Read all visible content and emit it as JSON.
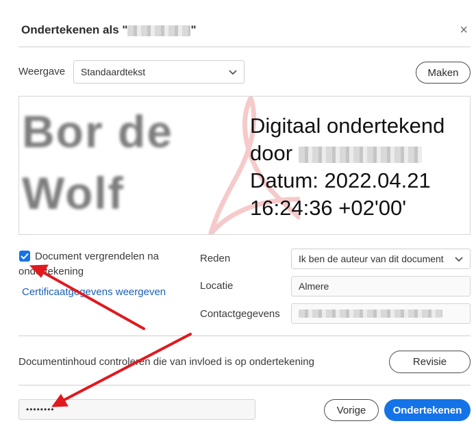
{
  "dialog": {
    "title_prefix": "Ondertekenen als \"",
    "title_suffix": "\"",
    "close_glyph": "×"
  },
  "appearance": {
    "label": "Weergave",
    "selected": "Standaardtekst",
    "make_button": "Maken"
  },
  "preview": {
    "name_lines": [
      "Bor de",
      "Wolf"
    ],
    "line1": "Digitaal ondertekend",
    "line2_prefix": "door",
    "line3": "Datum: 2022.04.21",
    "line4": "16:24:36 +02'00'"
  },
  "lock_document": {
    "checked": true,
    "label_line1": "Document vergrendelen na",
    "label_line2": "ondertekening"
  },
  "certificate_link": "Certificaatgegevens weergeven",
  "details": {
    "reason_label": "Reden",
    "reason_value": "Ik ben de auteur van dit document",
    "location_label": "Locatie",
    "location_value": "Almere",
    "contact_label": "Contactgegevens"
  },
  "review": {
    "text": "Documentinhoud controleren die van invloed is op ondertekening",
    "button": "Revisie"
  },
  "footer": {
    "password_value": "••••••••",
    "back_button": "Vorige",
    "sign_button": "Ondertekenen"
  },
  "colors": {
    "accent": "#1473e6",
    "annotation_arrow": "#e0191f"
  }
}
